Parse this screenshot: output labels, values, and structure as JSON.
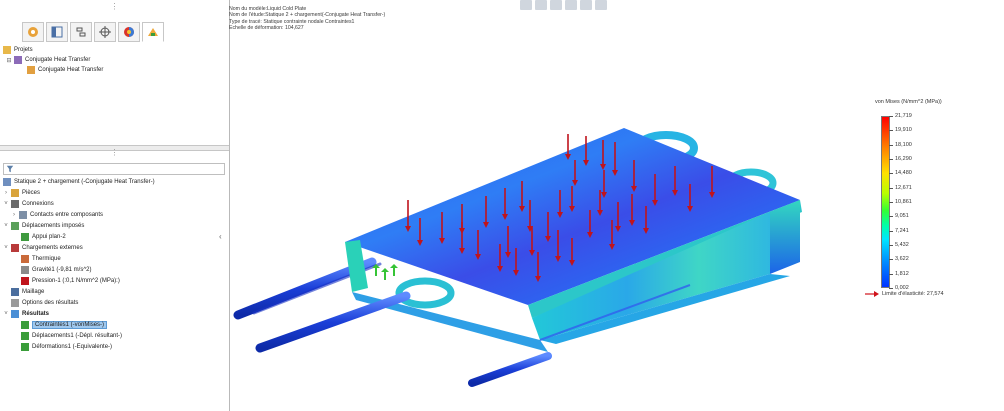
{
  "colors": {
    "accent": "#4a8fd6",
    "selection": "#9fc8ee",
    "arrow": "#c0141c",
    "yield": "#d0121a"
  },
  "panel": {
    "tabs": [
      "feature-manager",
      "property-manager",
      "configuration-manager",
      "dimxpert",
      "display-manager",
      "simulation"
    ],
    "projects": {
      "root": "Projets",
      "study": "Conjugate Heat Transfer",
      "child": "Conjugate Heat Transfer"
    },
    "study_tree": {
      "study": "Statique 2 + chargement (-Conjugate Heat Transfer-)",
      "parts": "Pièces",
      "connections": "Connexions",
      "contacts": "Contacts entre composants",
      "fixtures": "Déplacements imposés",
      "fixture1": "Appui plan-2",
      "loads": "Chargements externes",
      "thermal": "Thermique",
      "gravity": "Gravité1 (-9,81 m/s^2)",
      "pressure": "Pression-1 (:0,1 N/mm^2 (MPa):)",
      "mesh": "Maillage",
      "result_options": "Options des résultats",
      "results": "Résultats",
      "stress": "Contraintes1 (-vonMises-)",
      "displacement": "Déplacements1 (-Dépl. résultant-)",
      "strain": "Déformations1 (-Equivalente-)"
    }
  },
  "viewport": {
    "info": [
      "Nom du modèle:Liquid Cold Plate",
      "Nom de l'étude:Statique 2 + chargement(-Conjugate Heat Transfer-)",
      "Type de tracé: Statique contrainte nodale Contraintes1",
      "Echelle de déformation: 104,627"
    ]
  },
  "legend": {
    "title": "von Mises (N/mm^2 (MPa))",
    "ticks": [
      "21,719",
      "19,910",
      "18,100",
      "16,290",
      "14,480",
      "12,671",
      "10,861",
      "9,051",
      "7,241",
      "5,432",
      "3,622",
      "1,812",
      "0,002"
    ],
    "yield_label": "Limite d'élasticité: 27,574"
  }
}
